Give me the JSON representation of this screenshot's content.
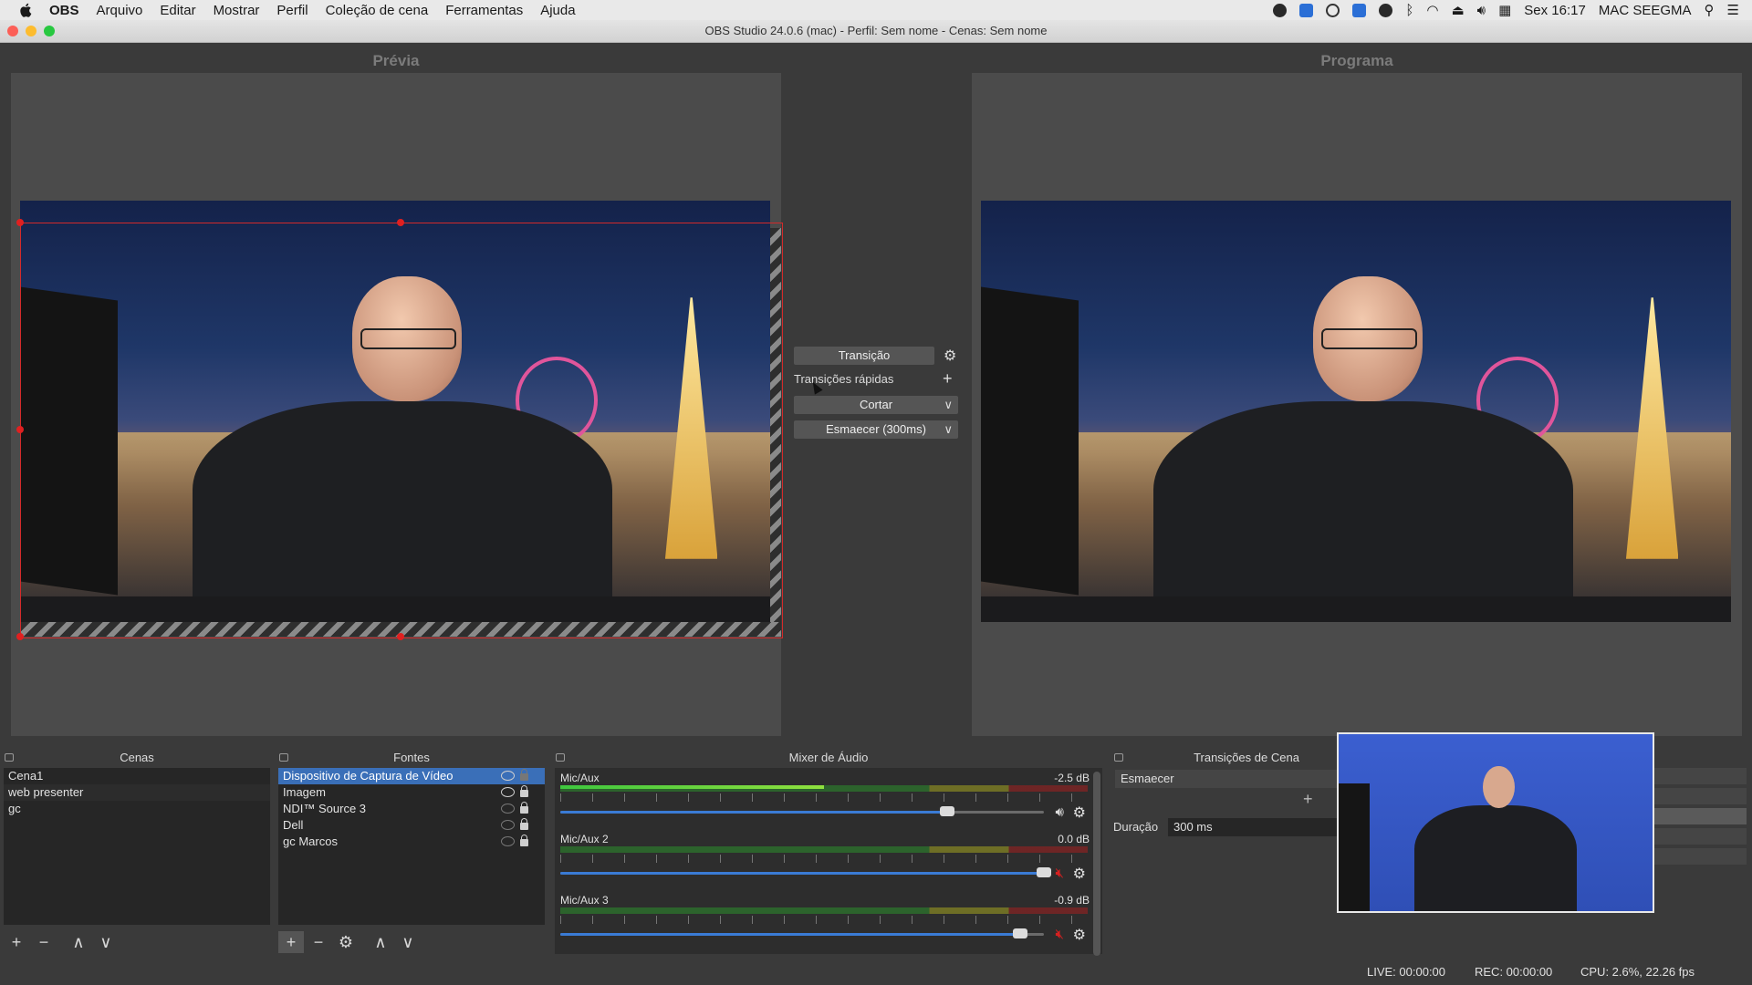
{
  "menubar": {
    "app_name": "OBS",
    "items": [
      "Arquivo",
      "Editar",
      "Mostrar",
      "Perfil",
      "Coleção de cena",
      "Ferramentas",
      "Ajuda"
    ],
    "clock": "Sex 16:17",
    "user": "MAC SEEGMA"
  },
  "window": {
    "title": "OBS Studio 24.0.6 (mac) - Perfil: Sem nome - Cenas: Sem nome"
  },
  "views": {
    "preview_label": "Prévia",
    "program_label": "Programa"
  },
  "transition_controls": {
    "transition_button": "Transição",
    "quick_transitions_label": "Transições rápidas",
    "cut_option": "Cortar",
    "fade_option": "Esmaecer (300ms)"
  },
  "scenes": {
    "title": "Cenas",
    "items": [
      "Cena1",
      "web presenter",
      "gc"
    ],
    "selected_index": 1
  },
  "sources": {
    "title": "Fontes",
    "items": [
      {
        "label": "Dispositivo de Captura de Vídeo",
        "visible": true,
        "locked": false,
        "selected": true
      },
      {
        "label": "Imagem",
        "visible": true,
        "locked": true,
        "selected": false
      },
      {
        "label": "NDI™ Source 3",
        "visible": false,
        "locked": true,
        "selected": false
      },
      {
        "label": "Dell",
        "visible": false,
        "locked": true,
        "selected": false
      },
      {
        "label": "gc Marcos",
        "visible": false,
        "locked": true,
        "selected": false
      }
    ]
  },
  "mixer": {
    "title": "Mixer de Áudio",
    "channels": [
      {
        "name": "Mic/Aux",
        "db": "-2.5 dB",
        "volume": 0.8,
        "level": 0.5,
        "muted": false
      },
      {
        "name": "Mic/Aux 2",
        "db": "0.0 dB",
        "volume": 1.0,
        "level": 0.0,
        "muted": true
      },
      {
        "name": "Mic/Aux 3",
        "db": "-0.9 dB",
        "volume": 0.95,
        "level": 0.0,
        "muted": true
      }
    ]
  },
  "scene_transitions": {
    "title": "Transições de Cena",
    "selected": "Esmaecer",
    "duration_label": "Duração",
    "duration_value": "300 ms"
  },
  "status": {
    "live": "LIVE: 00:00:00",
    "rec": "REC: 00:00:00",
    "cpu": "CPU: 2.6%, 22.26 fps"
  },
  "colors": {
    "selection": "#3a6fb8",
    "bounding_box": "#d42a2a",
    "muted_speaker": "#d62020"
  }
}
